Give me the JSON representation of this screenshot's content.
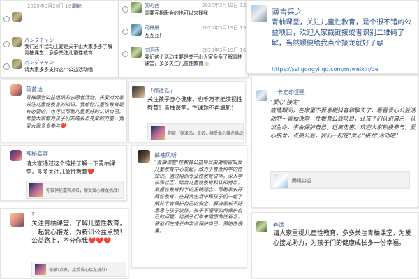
{
  "top_left_panel": {
    "top_date": "2020年3月20日 16:16",
    "top_tag": "删除",
    "messages": [
      {
        "name": "パンダチャン",
        "time": "",
        "text": "我们这个活动主要是关于山大家多多了解青柚课堂，多多关注儿童性教育"
      },
      {
        "name": "パンダチャン",
        "time": "",
        "text": "请大家多多支持这个公益活动哦"
      }
    ]
  },
  "top_mid_panel": {
    "messages": [
      {
        "name": "文昭茜",
        "time": "2020年3月19日 12:41",
        "text": "需要互相瞅会的也可以来找我"
      },
      {
        "name": "司林晨",
        "time": "2020年3月19日 15:44",
        "text": "互互互！"
      },
      {
        "name": "文昭茜",
        "time": "2020年3月19日 16:22",
        "text": "我们这个活动主要是关于山大家多多了解青柚课堂，多多关注儿童性教育👍🏻"
      }
    ]
  },
  "top_right_card": {
    "name": "薄言采之",
    "text": "青柚课堂，关注儿童性教育，是个很不错的公益项目，欢迎大家戳链接或者识别二维码了解，当然顺便给我点个接龙就好了😁",
    "link": "https://ssl.gongyi.qq.com/m/weixin/de"
  },
  "left_card_1": {
    "name": "蒋首达",
    "text": "青柚课堂公益组织的志愿者活动，关爱对大家关注儿童性教育的知识，我想你儿童性教育是有必要的，也可以帮助儿童更好的认识自己，希望大家都为孩子们的成长点亮爱的力量，我爱大家多多参与❤️"
  },
  "left_card_2": {
    "name": "神秘嘉宾",
    "text": "请大家通过这个链接了解一下青柚课堂，多多关注儿童性教育❤️",
    "share_text": "你被神秘嘉宾点名，接受爱心接龙挑战!"
  },
  "left_card_3": {
    "name": "?",
    "text": "关注青柚课堂，了解儿童性教育，一起爱心接龙，为腾讯公益点赞！公益路上，不分你我❤️❤️❤️",
    "share_text": "你被?点名，接受爱心接龙挑战!"
  },
  "mid_card_1": {
    "name": "「俪泽泓」",
    "text": "关注孩子身心健康，也千万不能漠视性教育！青柚课堂，性课题不再尴尬！",
    "share_text": "你被「俪泽泓」点名，接受爱心接龙挑战!"
  },
  "mid_card_2": {
    "name": "裤袖风听",
    "text": "\"青柚课堂\"性教育公益项目由湖南省妇女儿童教育中心发起，致力于普及科学的性知识。通过培训专业性教育讲师，深入学校和社区，结合儿童性教育和认知特点，掌握性教育科学的正确理念，帮助家长开展性教育，在日常生活中和孩子们一起了解并学会保护自己的安全，解决家长不好意思与孩子谈性，孩子不懂得如何保护自己的问题，给孩子们带来健康的性观念，使他们在成长中学会保护自己，预防性侵害。"
  },
  "right_card_1": {
    "name": "卡定印迎星",
    "text": "\"爱心\"接龙\"\n疫情期间，在家里不要总刷抖音和聊天了，看看爱心公益活动吧～青柚课堂，性教育公益项目，让孩子们认识自己，认识生命，学会保护自己，远离伤害。欢迎大家积极参与，爱心接龙，点亮公益，我们一起在\"爱心\"接龙\"活动吧！",
    "share_text": "腾讯公益"
  },
  "right_card_2": {
    "name": "春饿",
    "text": "请大家重视儿童性教育，多多关注青柚课堂，为爱心接龙助力，为孩子们的健康成长多一份幸福。"
  },
  "colors": {
    "name_blue": "#4b6694",
    "link_blue": "#2a6cc8",
    "highlight_yellow": "#ffd75c"
  }
}
